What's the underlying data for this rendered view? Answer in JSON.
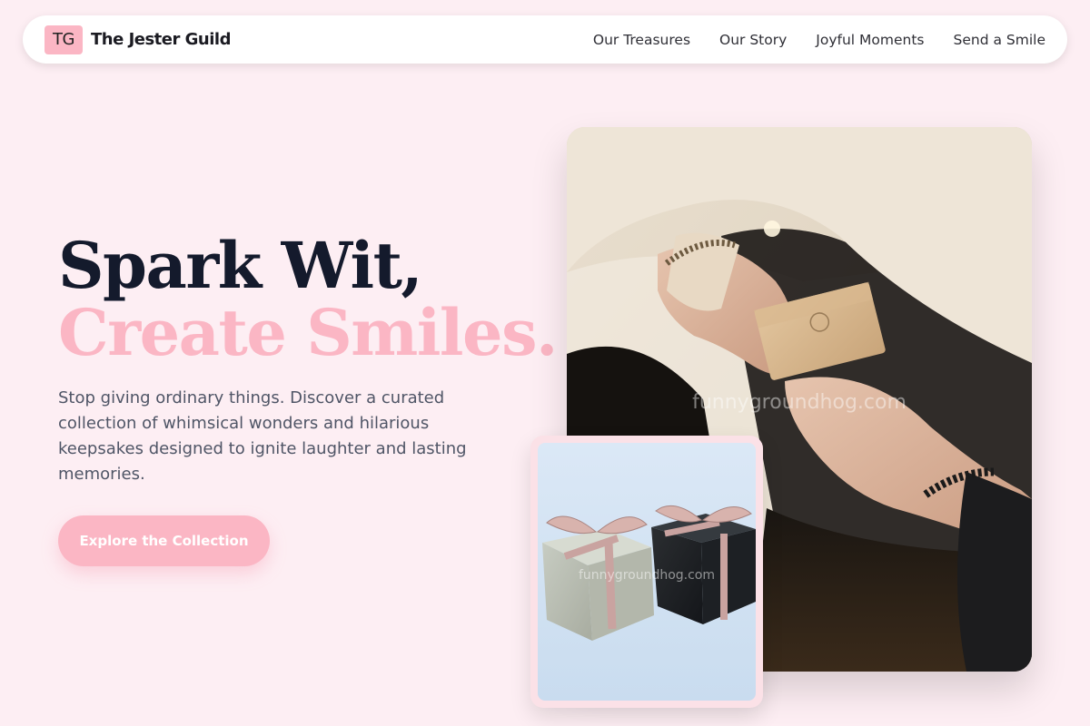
{
  "brand": {
    "badge": "TG",
    "name": "The Jester Guild"
  },
  "nav": {
    "links": [
      "Our Treasures",
      "Our Story",
      "Joyful Moments",
      "Send a Smile"
    ]
  },
  "hero": {
    "title_line1": "Spark Wit,",
    "title_line2": "Create Smiles.",
    "description": "Stop giving ordinary things. Discover a curated collection of whimsical wonders and hilarious keepsakes designed to ignite laughter and lasting memories.",
    "cta_label": "Explore the Collection"
  },
  "images": {
    "main_watermark": "funnygroundhog.com",
    "small_watermark": "funnygroundhog.com"
  },
  "colors": {
    "background": "#fdeef3",
    "accent_pink": "#fbb6c4",
    "heading_dark": "#141a2c",
    "body_text": "#4f5566"
  }
}
